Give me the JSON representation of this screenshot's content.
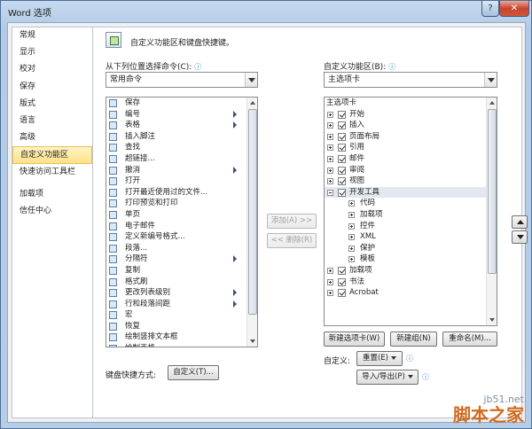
{
  "window": {
    "title": "Word 选项",
    "help_glyph": "?",
    "close_glyph": "✕"
  },
  "nav": {
    "items": [
      "常规",
      "显示",
      "校对",
      "保存",
      "版式",
      "语言",
      "高级",
      "自定义功能区",
      "快速访问工具栏",
      "加载项",
      "信任中心"
    ],
    "active": "自定义功能区"
  },
  "header": {
    "text": "自定义功能区和键盘快捷键。"
  },
  "left": {
    "label": "从下列位置选择命令(C):",
    "info": "ⓘ",
    "combo_value": "常用命令",
    "commands": [
      {
        "label": "保存",
        "sub": false
      },
      {
        "label": "编号",
        "sub": true
      },
      {
        "label": "表格",
        "sub": true
      },
      {
        "label": "插入脚注",
        "sub": false
      },
      {
        "label": "查找",
        "sub": false
      },
      {
        "label": "超链接...",
        "sub": false
      },
      {
        "label": "撤消",
        "sub": true
      },
      {
        "label": "打开",
        "sub": false
      },
      {
        "label": "打开最近使用过的文件...",
        "sub": false
      },
      {
        "label": "打印预览和打印",
        "sub": false
      },
      {
        "label": "单页",
        "sub": false
      },
      {
        "label": "电子邮件",
        "sub": false
      },
      {
        "label": "定义新编号格式...",
        "sub": false
      },
      {
        "label": "段落...",
        "sub": false
      },
      {
        "label": "分隔符",
        "sub": true
      },
      {
        "label": "复制",
        "sub": false
      },
      {
        "label": "格式刷",
        "sub": false
      },
      {
        "label": "更改列表级别",
        "sub": true
      },
      {
        "label": "行和段落间距",
        "sub": true
      },
      {
        "label": "宏",
        "sub": false
      },
      {
        "label": "恢复",
        "sub": false
      },
      {
        "label": "绘制竖排文本框",
        "sub": false
      },
      {
        "label": "绘制表格",
        "sub": false
      }
    ]
  },
  "middle": {
    "add_label": "添加(A) >>",
    "remove_label": "<< 删除(R)"
  },
  "right": {
    "label": "自定义功能区(B):",
    "info": "ⓘ",
    "combo_value": "主选项卡",
    "tree_header": "主选项卡",
    "tabs": [
      {
        "label": "开始",
        "level": 0,
        "expanded": false,
        "checkbox": true
      },
      {
        "label": "插入",
        "level": 0,
        "expanded": false,
        "checkbox": true
      },
      {
        "label": "页面布局",
        "level": 0,
        "expanded": false,
        "checkbox": true
      },
      {
        "label": "引用",
        "level": 0,
        "expanded": false,
        "checkbox": true
      },
      {
        "label": "邮件",
        "level": 0,
        "expanded": false,
        "checkbox": true
      },
      {
        "label": "审阅",
        "level": 0,
        "expanded": false,
        "checkbox": true
      },
      {
        "label": "视图",
        "level": 0,
        "expanded": false,
        "checkbox": true
      },
      {
        "label": "开发工具",
        "level": 0,
        "expanded": true,
        "checkbox": true,
        "selected": true
      },
      {
        "label": "代码",
        "level": 1,
        "expanded": false,
        "checkbox": false
      },
      {
        "label": "加载项",
        "level": 1,
        "expanded": false,
        "checkbox": false
      },
      {
        "label": "控件",
        "level": 1,
        "expanded": false,
        "checkbox": false
      },
      {
        "label": "XML",
        "level": 1,
        "expanded": false,
        "checkbox": false
      },
      {
        "label": "保护",
        "level": 1,
        "expanded": false,
        "checkbox": false
      },
      {
        "label": "模板",
        "level": 1,
        "expanded": false,
        "checkbox": false
      },
      {
        "label": "加载项",
        "level": 0,
        "expanded": false,
        "checkbox": true
      },
      {
        "label": "书法",
        "level": 0,
        "expanded": false,
        "checkbox": true
      },
      {
        "label": "Acrobat",
        "level": 0,
        "expanded": false,
        "checkbox": true
      }
    ],
    "new_tab_label": "新建选项卡(W)",
    "new_group_label": "新建组(N)",
    "rename_label": "重命名(M)...",
    "customize_label": "自定义:",
    "reset_label": "重置(E)",
    "import_export_label": "导入/导出(P)"
  },
  "keyboard": {
    "label": "键盘快捷方式:",
    "button_label": "自定义(T)..."
  },
  "watermark": {
    "line1": "jb51.net",
    "line2": "脚本之家"
  }
}
